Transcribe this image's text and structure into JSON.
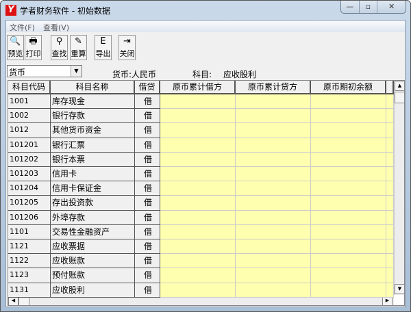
{
  "window": {
    "title": "学者财务软件 - 初始数据",
    "min": "—",
    "max": "▫",
    "close": "✕"
  },
  "menu": [
    "文件(F)",
    "查看(V)"
  ],
  "toolbar": [
    {
      "label": "预览",
      "icon": "preview-icon",
      "glyph": "🔍"
    },
    {
      "label": "打印",
      "icon": "printer-icon",
      "glyph": "🖶"
    },
    {
      "label": "查找",
      "icon": "binoculars-icon",
      "glyph": "⚲"
    },
    {
      "label": "重算",
      "icon": "recalc-icon",
      "glyph": "✎"
    },
    {
      "label": "导出",
      "icon": "export-icon",
      "glyph": "E"
    },
    {
      "label": "关闭",
      "icon": "exit-door-icon",
      "glyph": "⇥"
    }
  ],
  "filter": {
    "combo_value": "货币",
    "currency_label": "货币:人民币",
    "subject_label": "科目:",
    "subject_value": "应收股利"
  },
  "grid": {
    "columns": [
      "科目代码",
      "科目名称",
      "借贷",
      "原币累计借方",
      "原币累计贷方",
      "原币期初余额"
    ],
    "rows": [
      [
        "1001",
        "库存现金",
        "借"
      ],
      [
        "1002",
        "银行存款",
        "借"
      ],
      [
        "1012",
        "其他货币资金",
        "借"
      ],
      [
        "101201",
        "银行汇票",
        "借"
      ],
      [
        "101202",
        "银行本票",
        "借"
      ],
      [
        "101203",
        "信用卡",
        "借"
      ],
      [
        "101204",
        "信用卡保证金",
        "借"
      ],
      [
        "101205",
        "存出投资款",
        "借"
      ],
      [
        "101206",
        "外埠存款",
        "借"
      ],
      [
        "1101",
        "交易性金融资产",
        "借"
      ],
      [
        "1121",
        "应收票据",
        "借"
      ],
      [
        "1122",
        "应收账款",
        "借"
      ],
      [
        "1123",
        "预付账款",
        "借"
      ],
      [
        "1131",
        "应收股利",
        "借"
      ]
    ]
  },
  "colors": {
    "editable": "#ffffb0",
    "header": "#f0f0f0"
  }
}
